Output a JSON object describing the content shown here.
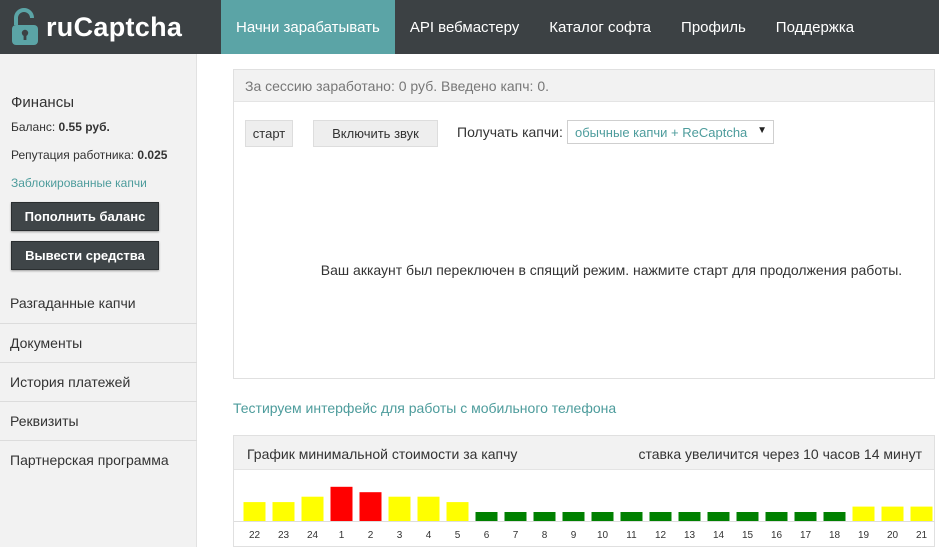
{
  "logo": {
    "text": "ruCaptcha",
    "icon": "padlock-icon"
  },
  "nav": [
    {
      "label": "Начни зарабатывать",
      "active": true
    },
    {
      "label": "API вебмастеру",
      "active": false
    },
    {
      "label": "Каталог софта",
      "active": false
    },
    {
      "label": "Профиль",
      "active": false
    },
    {
      "label": "Поддержка",
      "active": false
    }
  ],
  "finances": {
    "title": "Финансы",
    "balance_label": "Баланс:",
    "balance_value": "0.55 руб.",
    "reputation_label": "Репутация работника:",
    "reputation_value": "0.025",
    "blocked_link": "Заблокированные капчи",
    "topup_button": "Пополнить баланс",
    "withdraw_button": "Вывести средства"
  },
  "side_menu": [
    "Разгаданные капчи",
    "Документы",
    "История платежей",
    "Реквизиты",
    "Партнерская программа"
  ],
  "work": {
    "session_text": "За сессию заработано: 0 руб. Введено капч: 0.",
    "start_button": "старт",
    "sound_button": "Включить звук",
    "get_label": "Получать капчи:",
    "select_value": "обычные капчи + ReCaptcha",
    "sleep_message": "Ваш аккаунт был переключен в спящий режим. нажмите старт для продолжения работы."
  },
  "mobile_link": "Тестируем интерфейс для работы с мобильного телефона",
  "colors": {
    "header_bg": "#3c4144",
    "accent": "#5ba4a6",
    "link": "#4d9c9c",
    "bar_yellow": "#ffff00",
    "bar_red": "#ff0000",
    "bar_green": "#008000"
  },
  "chart_data": {
    "type": "bar",
    "title": "График минимальной стоимости за капчу",
    "subtitle": "ставка увеличится через 10 часов 14 минут",
    "categories": [
      "22",
      "23",
      "24",
      "1",
      "2",
      "3",
      "4",
      "5",
      "6",
      "7",
      "8",
      "9",
      "10",
      "11",
      "12",
      "13",
      "14",
      "15",
      "16",
      "17",
      "18",
      "19",
      "20",
      "21"
    ],
    "values": [
      2.1,
      2.1,
      2.7,
      3.8,
      3.2,
      2.7,
      2.7,
      2.1,
      1.0,
      1.0,
      1.0,
      1.0,
      1.0,
      1.0,
      1.0,
      1.0,
      1.0,
      1.0,
      1.0,
      1.0,
      1.0,
      1.6,
      1.6,
      1.6
    ],
    "bar_colors": [
      "yellow",
      "yellow",
      "yellow",
      "red",
      "red",
      "yellow",
      "yellow",
      "yellow",
      "green",
      "green",
      "green",
      "green",
      "green",
      "green",
      "green",
      "green",
      "green",
      "green",
      "green",
      "green",
      "green",
      "yellow",
      "yellow",
      "yellow"
    ],
    "ylim": [
      0,
      4
    ],
    "grid": false
  }
}
